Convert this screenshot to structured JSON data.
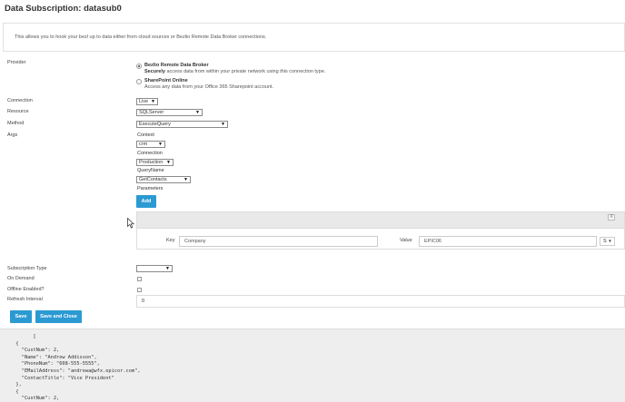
{
  "page": {
    "title": "Data Subscription: datasub0",
    "intro": "This allows you to hook your bezl up to data either from cloud sources or Bezlio Remote Data Broker connections."
  },
  "form": {
    "provider_label": "Provider",
    "providers": [
      {
        "title": "Bezlio Remote Data Broker",
        "desc_bold": "Securely",
        "desc": " access data from within your private network using this connection type.",
        "selected": true
      },
      {
        "title": "SharePoint Online",
        "desc_bold": "",
        "desc": "Access any data from your Office 365 Sharepoint account.",
        "selected": false
      }
    ],
    "connection_label": "Connection",
    "connection_value": "Live",
    "resource_label": "Resource",
    "resource_value": "SQLServer",
    "method_label": "Method",
    "method_value": "ExecuteQuery",
    "args_label": "Args",
    "args": {
      "context_label": "Context",
      "context_value": "crm",
      "connection_label": "Connection",
      "connection_value": "Production",
      "queryname_label": "QueryName",
      "queryname_value": "GetContacts",
      "parameters_label": "Parameters",
      "add_label": "Add"
    },
    "param": {
      "close": "X",
      "key_label": "Key",
      "key_value": "Company",
      "value_label": "Value",
      "value_value": "EPIC06",
      "type_symbol": "S"
    },
    "subscription_type_label": "Subscription Type",
    "subscription_type_value": "",
    "on_demand_label": "On Demand",
    "offline_label": "Offline Enabled?",
    "refresh_label": "Refresh Interval",
    "refresh_value": "0",
    "save_label": "Save",
    "save_close_label": "Save and Close"
  },
  "json_output": "        [\n  {\n    \"CustNum\": 2,\n    \"Name\": \"Andrew Addisson\",\n    \"PhoneNum\": \"608-555-5555\",\n    \"EMailAddress\": \"andrewa@wfx.epicor.com\",\n    \"ContactTitle\": \"Vice President\"\n  },\n  {\n    \"CustNum\": 2,",
  "colors": {
    "accent": "#2b9ad3",
    "panel": "#e9e9e9",
    "json_bg": "#eeeeee"
  }
}
